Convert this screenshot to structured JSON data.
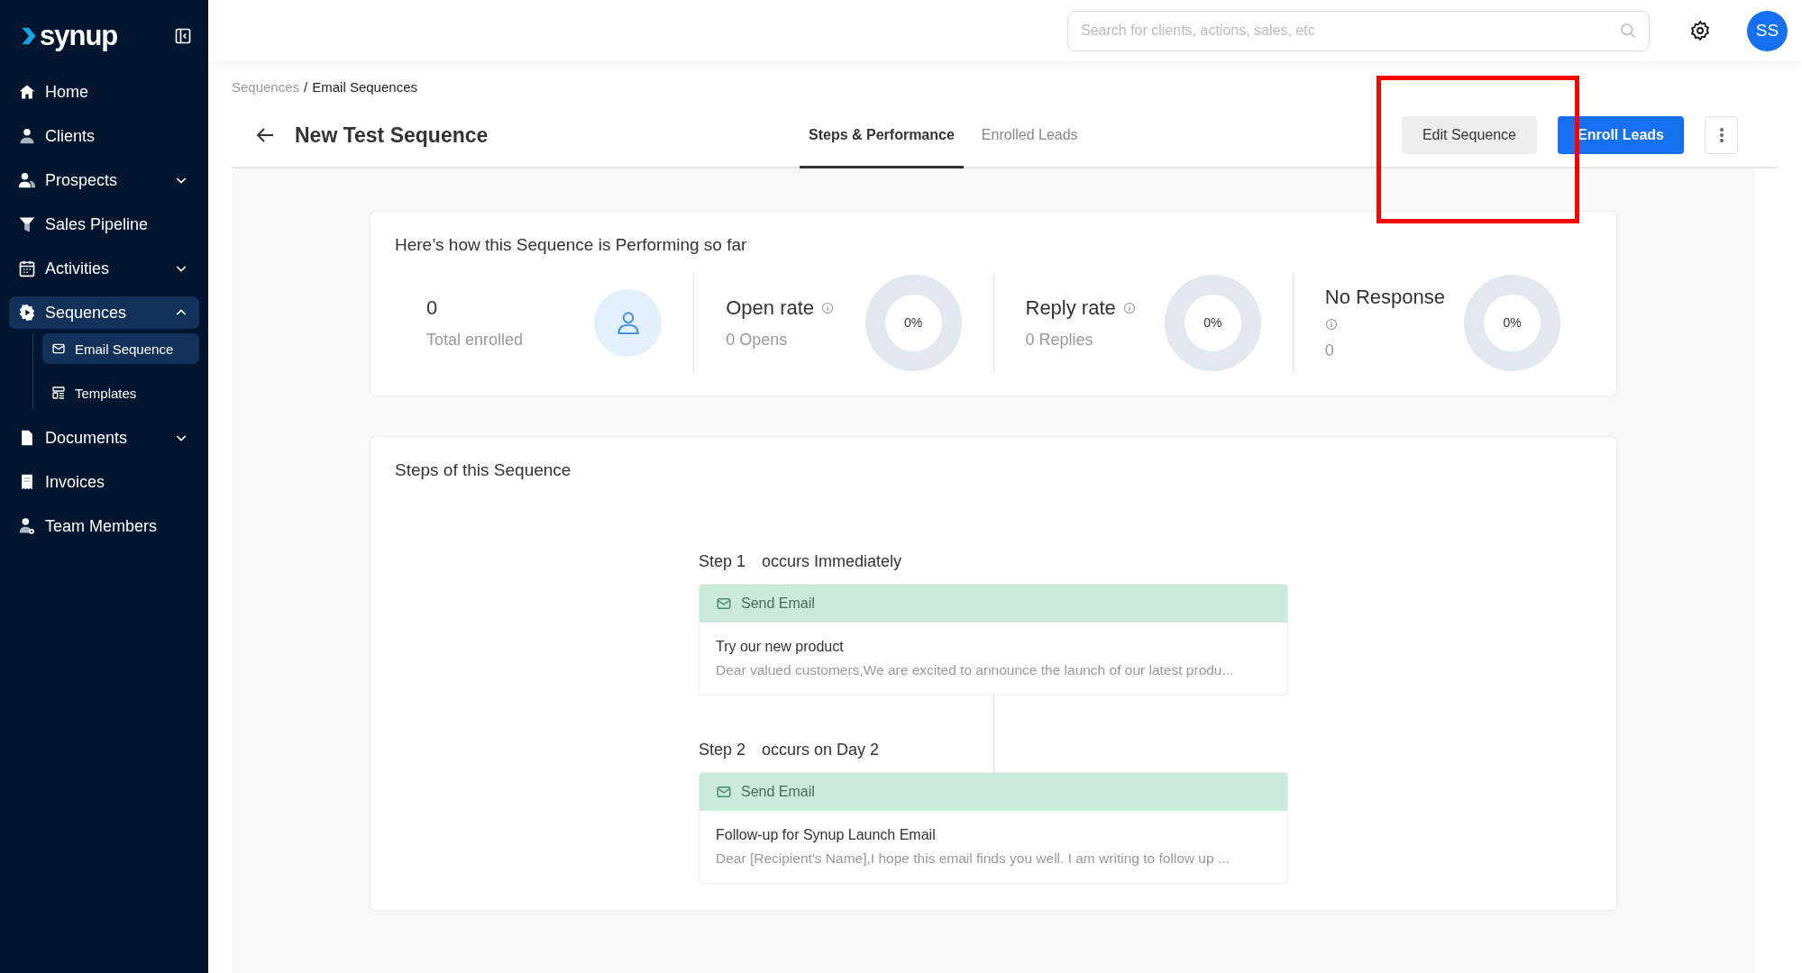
{
  "sidebar": {
    "logo": "synup",
    "items": [
      {
        "label": "Home",
        "selected": false
      },
      {
        "label": "Clients",
        "selected": false
      },
      {
        "label": "Prospects",
        "expanded": false,
        "selected": false
      },
      {
        "label": "Sales Pipeline",
        "selected": false
      },
      {
        "label": "Activities",
        "expanded": false,
        "selected": false
      },
      {
        "label": "Sequences",
        "expanded": true,
        "selected": true,
        "children": [
          {
            "label": "Email Sequence",
            "selected": true
          },
          {
            "label": "Templates",
            "selected": false
          }
        ]
      },
      {
        "label": "Documents",
        "expanded": false,
        "selected": false
      },
      {
        "label": "Invoices",
        "selected": false
      },
      {
        "label": "Team Members",
        "selected": false
      }
    ]
  },
  "topbar": {
    "search": {
      "placeholder": "Search for clients, actions, sales, etc"
    },
    "avatar": "SS"
  },
  "breadcrumb": {
    "separator": "/",
    "items": [
      {
        "label": "Sequences",
        "current": false
      },
      {
        "label": "Email Sequences",
        "current": true
      }
    ]
  },
  "header": {
    "title": "New Test Sequence",
    "tabs": [
      {
        "label": "Steps & Performance",
        "selected": true
      },
      {
        "label": "Enrolled Leads",
        "selected": false
      }
    ],
    "buttons": [
      {
        "label": "Edit Sequence",
        "kind": "secondary"
      },
      {
        "label": "Enroll Leads",
        "kind": "primary"
      }
    ]
  },
  "annotation": {
    "kind": "highlight-box",
    "color": "#ff0000"
  },
  "performance": {
    "title": "Here’s how this Sequence is Performing so far",
    "stats": [
      {
        "kind": "count",
        "value": "0",
        "label": "Total enrolled"
      },
      {
        "kind": "rate",
        "title": "Open rate",
        "label": "0 Opens",
        "reading": "0%"
      },
      {
        "kind": "rate",
        "title": "Reply rate",
        "label": "0 Replies",
        "reading": "0%"
      },
      {
        "kind": "rate-wrapped",
        "title": "No Response",
        "label": "0",
        "reading": "0%"
      }
    ]
  },
  "steps": {
    "title": "Steps of this Sequence",
    "items": [
      {
        "step": "Step 1",
        "timing": "occurs Immediately",
        "action": "Send Email",
        "subject": "Try our new product",
        "preview": "Dear valued customers,We are excited to announce the launch of our latest produ..."
      },
      {
        "step": "Step 2",
        "timing": "occurs on Day 2",
        "action": "Send Email",
        "subject": "Follow-up for Synup Launch Email",
        "preview": "Dear [Recipient's Name],I hope this email finds you well. I am writing to follow up ..."
      }
    ]
  }
}
